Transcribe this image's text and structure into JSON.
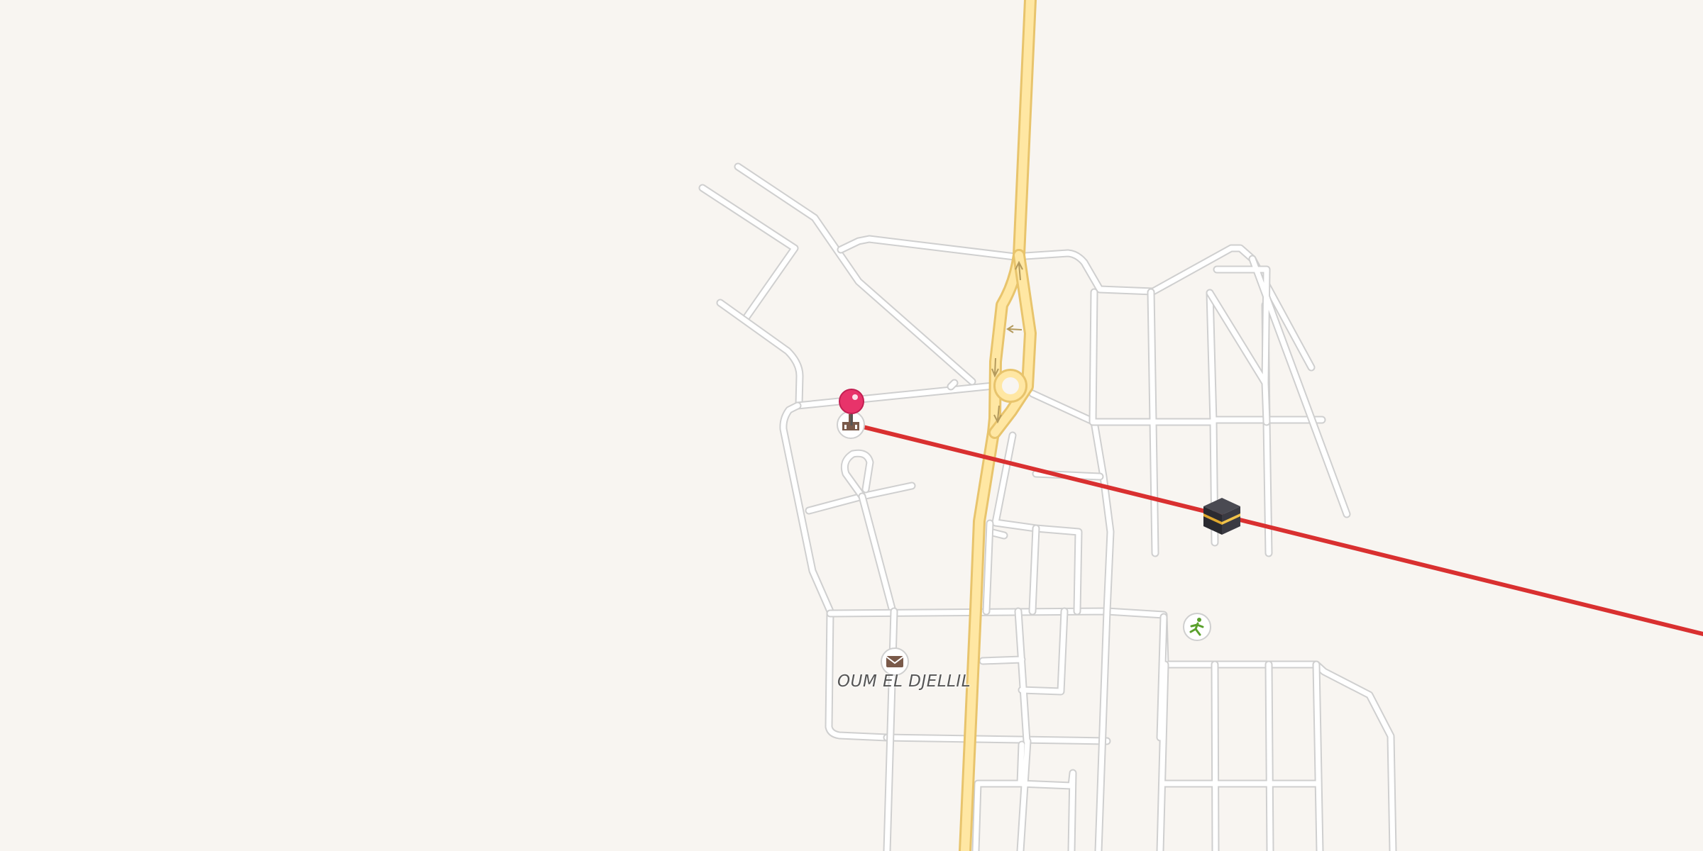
{
  "map": {
    "place_label": "OUM EL DJELLIL",
    "colors": {
      "background": "#f8f5f1",
      "minor_road": "#ffffff",
      "minor_road_casing": "#cfcfcf",
      "highway": "#ffe7a3",
      "highway_casing": "#e8c46c",
      "qibla_line": "#d93030",
      "pin": "#e8336a"
    },
    "markers": [
      {
        "name": "location-pin",
        "icon": "pin-icon"
      },
      {
        "name": "mosque-poi",
        "icon": "mosque-icon"
      },
      {
        "name": "kaaba-marker",
        "icon": "kaaba-icon"
      },
      {
        "name": "post-office-poi",
        "icon": "envelope-icon"
      },
      {
        "name": "sports-poi",
        "icon": "running-person-icon"
      }
    ],
    "overlay": {
      "name": "qibla-direction-line",
      "description_visible": false
    }
  }
}
